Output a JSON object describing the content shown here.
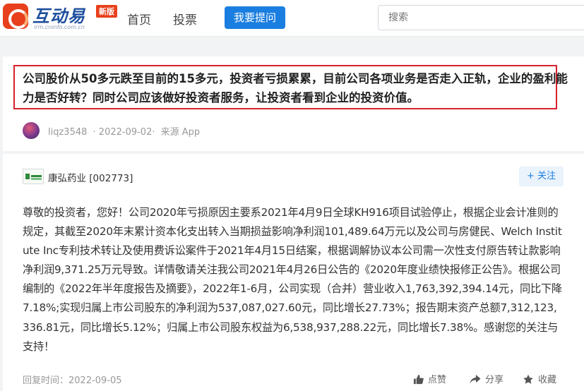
{
  "header": {
    "logo_text": "互动易",
    "logo_sub": "irm.cninfo.com.cn",
    "logo_badge": "新版",
    "nav": {
      "home": "首页",
      "vote": "投票"
    },
    "ask_button": "我要提问",
    "search_placeholder": "搜索"
  },
  "question": {
    "text": "公司股价从50多元跌至目前的15多元，投资者亏损累累，目前公司各项业务是否走入正轨，企业的盈利能力是否好转？同时公司应该做好投资者服务，让投资者看到企业的投资价值。",
    "author": "liqz3548",
    "date": "· 2022-09-02·",
    "source": "来源 App"
  },
  "answer": {
    "company": "康弘药业 [002773]",
    "follow_label": "+ 关注",
    "text": "尊敬的投资者，您好！公司2020年亏损原因主要系2021年4月9日全球KH916项目试验停止，根据企业会计准则的规定，其截至2020年末累计资本化支出转入当期损益影响净利润101,489.64万元以及公司与房健民、Welch Institute Inc专利技术转让及使用费诉讼案件于2021年4月15日结案，根据调解协议本公司需一次性支付原告转让款影响净利润9,371.25万元导致。详情敬请关注我公司2021年4月26日公告的《2020年度业绩快报修正公告》。根据公司编制的《2022年半年度报告及摘要》，2022年1-6月，公司实现（合并）营业收入1,763,392,394.14元，同比下降7.18%;实现归属上市公司股东的净利润为537,087,027.60元，同比增长27.73%；报告期末资产总额7,312,123,336.81元，同比增长5.12%；归属上市公司股东权益为6,538,937,288.22元，同比增长7.38%。感谢您的关注与支持！",
    "reply_time": "回复时间：2022-09-05",
    "actions": {
      "like": "点赞",
      "share": "分享",
      "favorite": "收藏"
    }
  },
  "colors": {
    "accent": "#1a7ee0",
    "highlight_border": "#d8202b",
    "brand": "#e8401c"
  }
}
